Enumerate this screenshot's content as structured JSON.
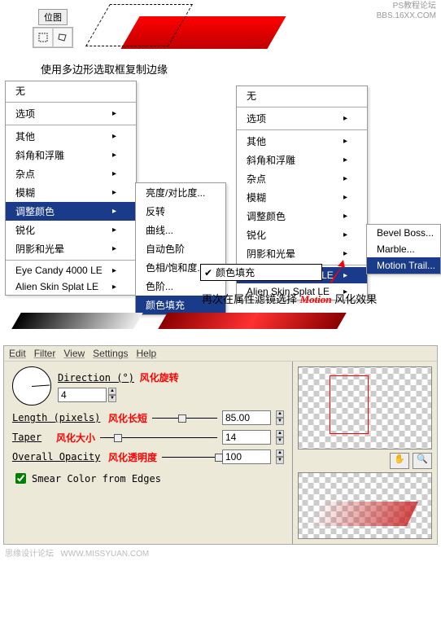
{
  "watermark": {
    "line1": "PS教程论坛",
    "line2": "BBS.16XX.COM"
  },
  "toolbox": {
    "label": "位图"
  },
  "caption1": "使用多边形选取框复制边缘",
  "menu1": {
    "items": [
      {
        "label": "无",
        "arrow": false
      },
      {
        "sep": true
      },
      {
        "label": "选项",
        "arrow": true
      },
      {
        "sep": true
      },
      {
        "label": "其他",
        "arrow": true
      },
      {
        "label": "斜角和浮雕",
        "arrow": true
      },
      {
        "label": "杂点",
        "arrow": true
      },
      {
        "label": "模糊",
        "arrow": true
      },
      {
        "label": "调整颜色",
        "arrow": true,
        "hi": true
      },
      {
        "label": "锐化",
        "arrow": true
      },
      {
        "label": "阴影和光晕",
        "arrow": true
      },
      {
        "sep": true
      },
      {
        "label": "Eye Candy 4000 LE",
        "arrow": true
      },
      {
        "label": "Alien Skin Splat LE",
        "arrow": true
      }
    ]
  },
  "menu2": {
    "items": [
      {
        "label": "亮度/对比度..."
      },
      {
        "label": "反转"
      },
      {
        "label": "曲线..."
      },
      {
        "label": "自动色阶"
      },
      {
        "label": "色相/饱和度..."
      },
      {
        "label": "色阶..."
      },
      {
        "label": "颜色填充",
        "hi": true
      }
    ]
  },
  "menu3": {
    "items": [
      {
        "label": "无",
        "arrow": false
      },
      {
        "sep": true
      },
      {
        "label": "选项",
        "arrow": true
      },
      {
        "sep": true
      },
      {
        "label": "其他",
        "arrow": true
      },
      {
        "label": "斜角和浮雕",
        "arrow": true
      },
      {
        "label": "杂点",
        "arrow": true
      },
      {
        "label": "模糊",
        "arrow": true
      },
      {
        "label": "调整颜色",
        "arrow": true
      },
      {
        "label": "锐化",
        "arrow": true
      },
      {
        "label": "阴影和光晕",
        "arrow": true
      },
      {
        "sep": true
      },
      {
        "label": "Eye Candy 4000 LE",
        "arrow": true,
        "hi": true
      },
      {
        "label": "Alien Skin Splat LE",
        "arrow": true
      }
    ]
  },
  "menu4": {
    "items": [
      {
        "label": "Bevel Boss..."
      },
      {
        "label": "Marble..."
      },
      {
        "label": "Motion Trail...",
        "hi": true
      }
    ]
  },
  "dropdown": {
    "check": "✔",
    "label": "颜色填充"
  },
  "caption2": {
    "pre": "再次在属性滤镜选择 ",
    "motion": "Motion",
    "post": " 风化效果"
  },
  "dialog": {
    "menubar": [
      "Edit",
      "Filter",
      "View",
      "Settings",
      "Help"
    ],
    "direction_label": "Direction (°)",
    "direction_note": "风化旋转",
    "direction_value": "4",
    "length_label": "Length (pixels)",
    "length_note": "风化长短",
    "length_value": "85.00",
    "taper_label": "Taper",
    "taper_note": "风化大小",
    "taper_value": "14",
    "opacity_label": "Overall Opacity",
    "opacity_note": "风化透明度",
    "opacity_value": "100",
    "smear": "Smear Color from Edges"
  },
  "footer": {
    "line1": "思缘设计论坛",
    "line2": "WWW.MISSYUAN.COM"
  }
}
